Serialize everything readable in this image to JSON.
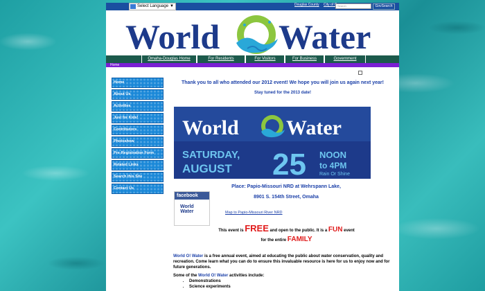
{
  "topbar": {
    "language_label": "Select Language",
    "links": [
      "Douglas County",
      "City of O"
    ],
    "search_placeholder": "Search",
    "search_button": "GovSearch"
  },
  "logo": {
    "text_left": "World",
    "text_o": "O!",
    "text_right": "Water"
  },
  "nav": {
    "items": [
      "Omaha-Douglas Home",
      "For Residents",
      "For Visitors",
      "For Business",
      "Government"
    ]
  },
  "breadcrumb": {
    "home": "Home"
  },
  "sidebar": {
    "items": [
      "Home",
      "About Us",
      "Activities",
      "Just for Kids!",
      "Contributors",
      "Photoshow",
      "Pre-Registration Form",
      "Related Links",
      "Search this Site",
      "Contact Us"
    ]
  },
  "main": {
    "thanks": "Thank you to all who attended our 2012 event!  We hope you will join us again next year!",
    "stay_tuned": "Stay tuned for the 2013 date!",
    "banner": {
      "title": "World O! Water",
      "day": "SATURDAY,",
      "month": "AUGUST",
      "date": "25",
      "time1": "NOON",
      "time2": "to 4PM",
      "rain": "Rain Or Shine"
    },
    "place": "Place:  Papio-Missouri NRD at Wehrspann Lake,",
    "address": "8901 S. 154th Street, Omaha",
    "facebook": "facebook",
    "fb_logo_line1": "World",
    "fb_logo_line2": "Water",
    "map_link": "Map to Papio-Missouri River NRD",
    "free_pre": "This event is ",
    "free_word": "FREE",
    "free_mid": " and open to the public. It is a ",
    "fun_word": "FUN",
    "free_post": " event",
    "entire": "for the entire ",
    "family": "FAMILY",
    "desc_name": "World O! Water",
    "desc_text": " is a free annual event, aimed at educating the public about water conservation, quality and recreation. Come learn what you can do to ensure this invaluable resource is here for us to enjoy now and for future generations.",
    "acts_pre": "Some of the ",
    "acts_name": "World O! Water",
    "acts_post": " activities include:",
    "activities": [
      "Demonstrations",
      "Science experiments"
    ]
  },
  "colors": {
    "brand_blue": "#1a3fa8",
    "nav_green": "#1c5a4c",
    "accent_purple": "#7a1fd3",
    "red": "#e01b1b"
  }
}
